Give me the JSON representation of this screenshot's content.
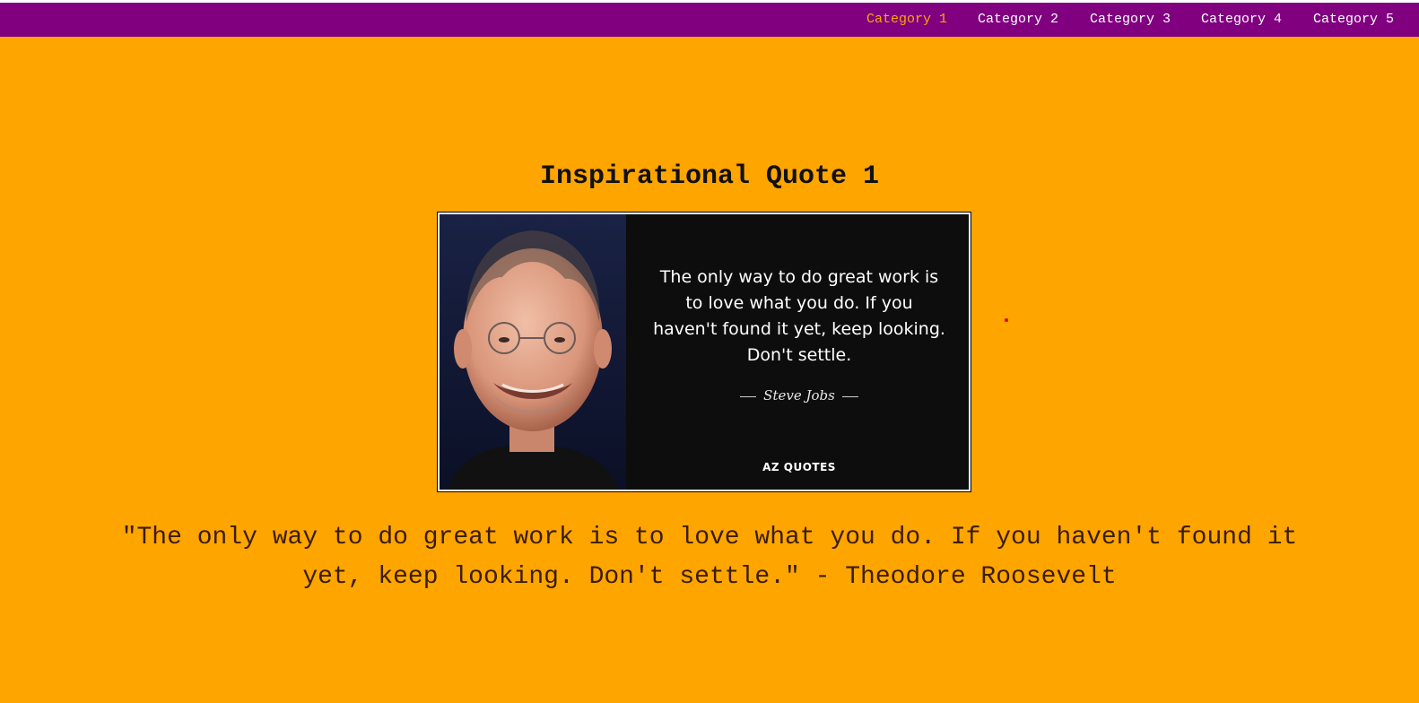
{
  "nav": {
    "items": [
      {
        "label": "Category 1",
        "active": true
      },
      {
        "label": "Category 2",
        "active": false
      },
      {
        "label": "Category 3",
        "active": false
      },
      {
        "label": "Category 4",
        "active": false
      },
      {
        "label": "Category 5",
        "active": false
      }
    ]
  },
  "main": {
    "title": "Inspirational Quote 1",
    "image": {
      "quote_text": "The only way to do great work is to love what you do. If you haven't found it yet, keep looking. Don't settle.",
      "author": "Steve Jobs",
      "brand": "AZ QUOTES"
    },
    "caption": "\"The only way to do great work is to love what you do. If you haven't found it yet, keep looking. Don't settle.\" - Theodore Roosevelt"
  },
  "colors": {
    "background": "#ffa500",
    "navbar": "#800080",
    "nav_text": "#ffffff",
    "nav_active": "#ffa500"
  }
}
